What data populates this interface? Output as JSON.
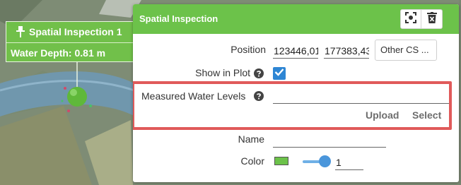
{
  "map": {
    "label_title": "Spatial Inspection 1",
    "label_value": "Water Depth: 0.81 m"
  },
  "panel": {
    "title": "Spatial Inspection",
    "header_icons": [
      "focus-icon",
      "delete-icon"
    ],
    "position": {
      "label": "Position",
      "x_value": "123446,01",
      "y_value": "177383,43",
      "other_cs_label": "Other CS ..."
    },
    "show_in_plot": {
      "label": "Show in Plot",
      "checked": true
    },
    "measured_water_levels": {
      "label": "Measured Water Levels",
      "value": "",
      "upload_label": "Upload",
      "select_label": "Select"
    },
    "name": {
      "label": "Name",
      "value": ""
    },
    "color": {
      "label": "Color",
      "swatch": "#6cc24a",
      "size_value": "1"
    }
  },
  "colors": {
    "accent": "#6cc24a",
    "highlight": "#e05a5a",
    "checkbox": "#2e86d4"
  }
}
